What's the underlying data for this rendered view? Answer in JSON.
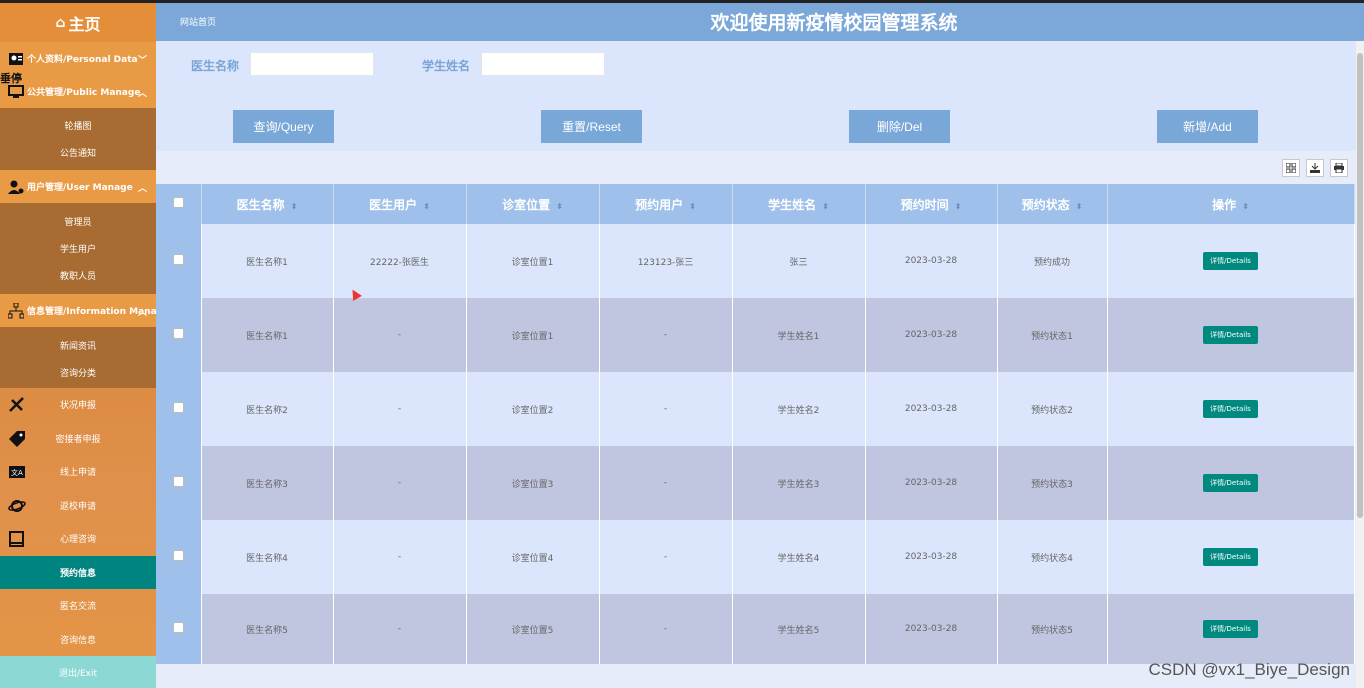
{
  "sidebar": {
    "home_label": "主页",
    "groups": [
      {
        "label": "个人资料/Personal Data",
        "expanded": false
      },
      {
        "label": "公共管理/Public Manage",
        "expanded": true,
        "items": [
          "轮播图",
          "公告通知"
        ]
      },
      {
        "label": "用户管理/User Manage",
        "expanded": true,
        "items": [
          "管理员",
          "学生用户",
          "教职人员"
        ]
      },
      {
        "label": "信息管理/Information Manage",
        "expanded": true,
        "items": [
          "新闻资讯",
          "咨询分类"
        ]
      }
    ],
    "nav": [
      {
        "label": "状况申报",
        "icon": "pencil-ruler-icon"
      },
      {
        "label": "密接者申报",
        "icon": "tag-icon"
      },
      {
        "label": "线上申请",
        "icon": "translate-icon"
      },
      {
        "label": "返校申请",
        "icon": "planet-icon"
      },
      {
        "label": "心理咨询",
        "icon": "book-icon"
      },
      {
        "label": "预约信息",
        "icon": "",
        "active": true
      },
      {
        "label": "匿名交流",
        "icon": ""
      },
      {
        "label": "咨询信息",
        "icon": ""
      }
    ],
    "exit_label": "退出/Exit",
    "stray_text": "垂停"
  },
  "header": {
    "breadcrumb": "网站首页",
    "title": "欢迎使用新疫情校园管理系统"
  },
  "filters": {
    "doctor_name_label": "医生名称",
    "student_name_label": "学生姓名",
    "doctor_name_value": "",
    "student_name_value": ""
  },
  "buttons": {
    "query": "查询/Query",
    "reset": "重置/Reset",
    "delete": "删除/Del",
    "add": "新增/Add"
  },
  "table": {
    "columns": [
      "医生名称",
      "医生用户",
      "诊室位置",
      "预约用户",
      "学生姓名",
      "预约时间",
      "预约状态",
      "操作"
    ],
    "details_label": "详情/Details",
    "rows": [
      [
        "医生名称1",
        "22222-张医生",
        "诊室位置1",
        "123123-张三",
        "张三",
        "2023-03-28",
        "预约成功"
      ],
      [
        "医生名称1",
        "-",
        "诊室位置1",
        "-",
        "学生姓名1",
        "2023-03-28",
        "预约状态1"
      ],
      [
        "医生名称2",
        "-",
        "诊室位置2",
        "-",
        "学生姓名2",
        "2023-03-28",
        "预约状态2"
      ],
      [
        "医生名称3",
        "-",
        "诊室位置3",
        "-",
        "学生姓名3",
        "2023-03-28",
        "预约状态3"
      ],
      [
        "医生名称4",
        "-",
        "诊室位置4",
        "-",
        "学生姓名4",
        "2023-03-28",
        "预约状态4"
      ],
      [
        "医生名称5",
        "-",
        "诊室位置5",
        "-",
        "学生姓名5",
        "2023-03-28",
        "预约状态5"
      ]
    ]
  },
  "watermark": "CSDN @vx1_Biye_Design",
  "colors": {
    "sidebar_bg": "#e8923a",
    "active_nav": "#00847f",
    "header_bg": "#7ba8d9",
    "button_bg": "#79a7d8",
    "details_bg": "#00897f"
  }
}
